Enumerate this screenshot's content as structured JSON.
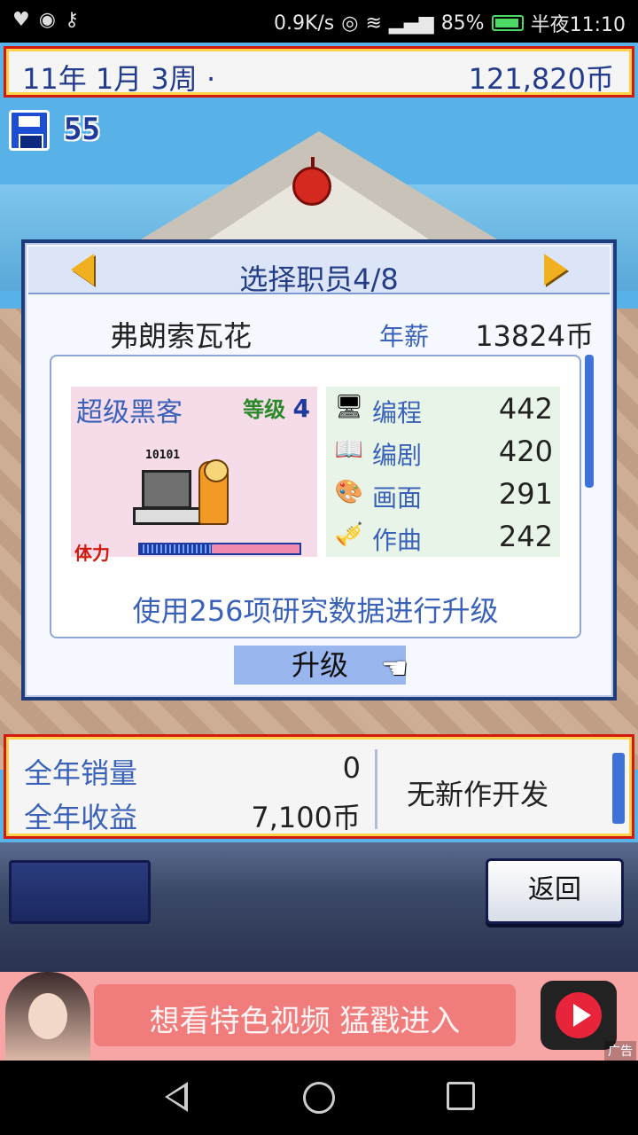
{
  "status_bar": {
    "net_speed": "0.9K/s",
    "network": "4G",
    "battery": "85%",
    "time": "半夜11:10"
  },
  "top_bar": {
    "date": "11年 1月 3周 ·",
    "money": "121,820币"
  },
  "save": {
    "count": "55"
  },
  "dialog": {
    "title": "选择职员4/8",
    "staff_name": "弗朗索瓦花",
    "salary_label": "年薪",
    "salary_value": "13824币",
    "card": {
      "job_title": "超级黑客",
      "level_label": "等级",
      "level_value": "4",
      "art_digits": "10101",
      "stamina_label": "体力",
      "stamina_fraction": 0.45
    },
    "stats": [
      {
        "icon": "computer-icon",
        "label": "编程",
        "value": "442"
      },
      {
        "icon": "script-book-icon",
        "label": "编剧",
        "value": "420"
      },
      {
        "icon": "paint-palette-icon",
        "label": "画面",
        "value": "291"
      },
      {
        "icon": "trumpet-icon",
        "label": "作曲",
        "value": "242"
      }
    ],
    "upgrade_note": "使用256项研究数据进行升级",
    "upgrade_button": "升级"
  },
  "summary": {
    "sales_label": "全年销量",
    "sales_value": "0",
    "revenue_label": "全年收益",
    "revenue_value": "7,100币",
    "status": "无新作开发"
  },
  "lower": {
    "back_label": "返回"
  },
  "ad": {
    "text": "想看特色视频  猛戳进入",
    "tag": "广告"
  }
}
